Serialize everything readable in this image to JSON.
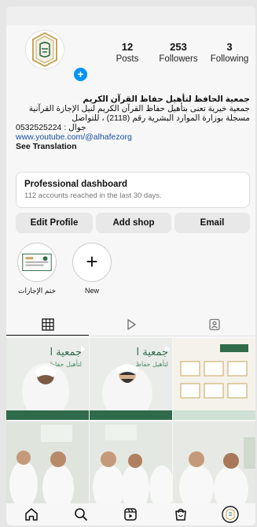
{
  "profile": {
    "stats": [
      {
        "value": "12",
        "label": "Posts"
      },
      {
        "value": "253",
        "label": "Followers"
      },
      {
        "value": "3",
        "label": "Following"
      }
    ],
    "name": "جمعية الحافظ لتأهيل حفاظ القرآن الكريم",
    "bio_line1": "جمعية خيرية تعنى بتأهيل حفاظ القرآن الكريم لنيل الإجازة القرآنية",
    "bio_line2": "مسجلة بوزارة الموارد البشرية رقم (2118) ، للتواصل",
    "bio_line3": "جوال : 0532525224",
    "link": "www.youtube.com/@alhafezorg",
    "see_translation": "See Translation"
  },
  "dashboard": {
    "title": "Professional dashboard",
    "subtitle": "112 accounts reached in the last 30 days."
  },
  "buttons": {
    "edit": "Edit Profile",
    "shop": "Add shop",
    "email": "Email"
  },
  "highlights": [
    {
      "label": "ختم الإجازات"
    },
    {
      "label": "New"
    }
  ],
  "tabs": [
    "grid-icon",
    "reels-icon",
    "tagged-icon"
  ],
  "posts": [
    {
      "caption": "جمعية ا",
      "sub": "لتأهيل حفاظ"
    },
    {
      "caption": "جمعية ا",
      "sub": "لتأهيل حفاظ"
    },
    {
      "caption": "",
      "sub": ""
    }
  ],
  "nav": [
    "home-icon",
    "search-icon",
    "reels-icon",
    "shop-icon",
    "profile-icon"
  ],
  "colors": {
    "accent": "#0095f6",
    "link": "#1a4fa0",
    "post_green": "#2f6b4a"
  }
}
